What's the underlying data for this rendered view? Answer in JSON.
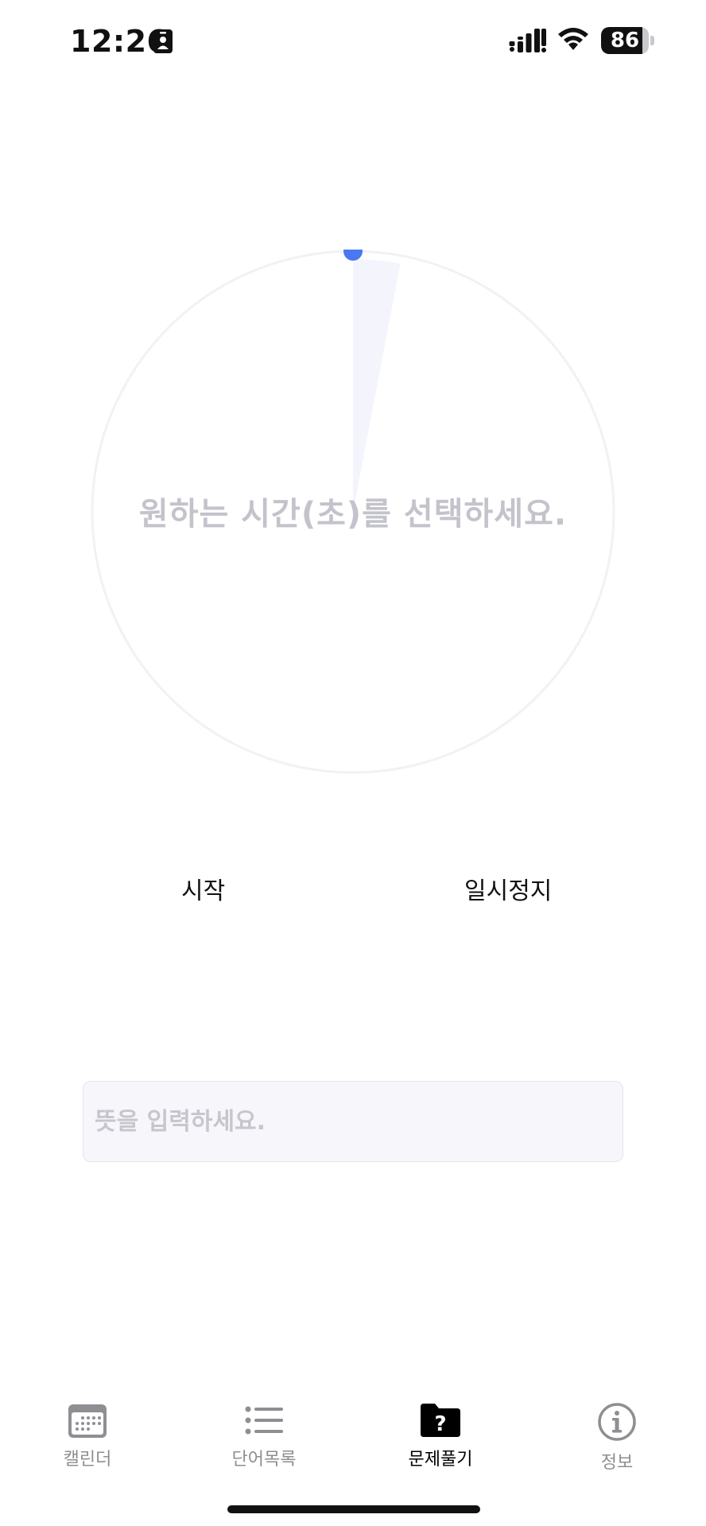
{
  "status_bar": {
    "time": "12:26",
    "battery_level": "86",
    "battery_fraction": 0.86
  },
  "timer": {
    "prompt": "원하는 시간(초)를 선택하세요.",
    "selected_fraction": 0.03,
    "accent_color": "#4a78f0",
    "track_color": "#f1f1f6"
  },
  "controls": {
    "start_label": "시작",
    "pause_label": "일시정지"
  },
  "answer": {
    "placeholder": "뜻을 입력하세요.",
    "value": ""
  },
  "tab_bar": {
    "items": [
      {
        "label": "캘린더",
        "icon": "calendar-icon",
        "active": false
      },
      {
        "label": "단어목록",
        "icon": "list-icon",
        "active": false
      },
      {
        "label": "문제풀기",
        "icon": "question-folder-icon",
        "active": true
      },
      {
        "label": "정보",
        "icon": "info-icon",
        "active": false
      }
    ]
  }
}
